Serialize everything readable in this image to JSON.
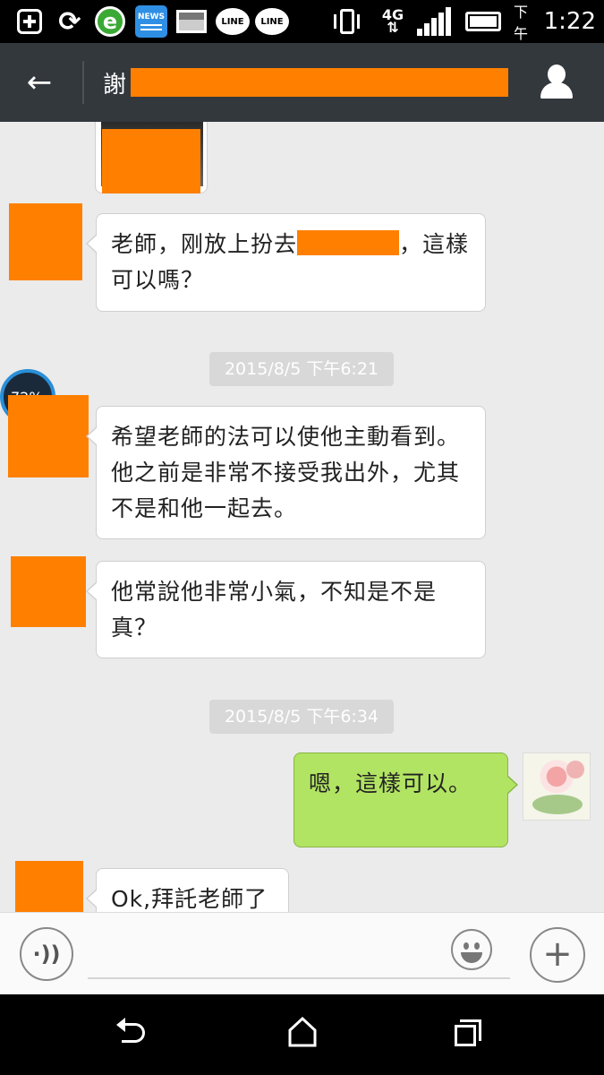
{
  "status_bar": {
    "icons": [
      "plus-square-icon",
      "sync-icon",
      "ie-browser-icon",
      "news-app-icon",
      "picture-icon",
      "line-app-icon",
      "line-app-icon",
      "vibrate-icon",
      "network-4g-icon",
      "signal-icon",
      "battery-icon"
    ],
    "ie_glyph": "e",
    "news_label": "NEWS",
    "line1_label": "LINE",
    "line2_label": "LINE",
    "network": "4G",
    "time_period": "下午",
    "time": "1:22"
  },
  "header": {
    "title": "謝"
  },
  "badge": {
    "text": "72%"
  },
  "messages": [
    {
      "part1": "老師，刚放上扮去",
      "part2": "，這樣可以嗎？"
    },
    {
      "text": "希望老師的法可以使他主動看到。他之前是非常不接受我出外，尤其不是和他一起去。"
    },
    {
      "text": "他常說他非常小氣，不知是不是真？"
    },
    {
      "text": "嗯，這樣可以。"
    },
    {
      "text": "Ok,拜託老師了"
    }
  ],
  "timestamps": [
    "2015/8/5 下午6:21",
    "2015/8/5 下午6:34"
  ],
  "input": {
    "placeholder": "",
    "voice_glyph": "·))",
    "plus_glyph": "+"
  },
  "colors": {
    "header_bg": "#33383d",
    "redaction": "#ff8000",
    "sent_bubble": "#b2e463",
    "chat_bg": "#ebebeb"
  }
}
